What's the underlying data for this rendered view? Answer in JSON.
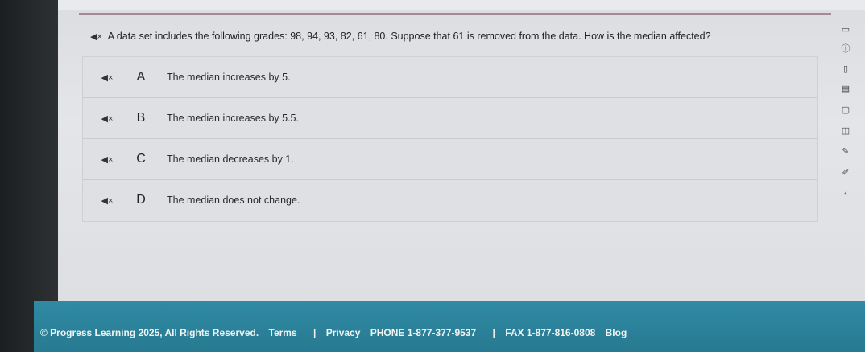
{
  "question": {
    "text": "A data set includes the following grades: 98, 94, 93, 82, 61, 80. Suppose that 61 is removed from the data. How is the median affected?"
  },
  "options": [
    {
      "letter": "A",
      "text": "The median increases by 5."
    },
    {
      "letter": "B",
      "text": "The median increases by 5.5."
    },
    {
      "letter": "C",
      "text": "The median decreases by 1."
    },
    {
      "letter": "D",
      "text": "The median does not change."
    }
  ],
  "toolbar": {
    "icons": [
      "bookmark-icon",
      "info-icon",
      "calculator-icon",
      "notes-icon",
      "formula-icon",
      "reference-icon",
      "pencil-icon",
      "highlighter-icon",
      "scroll-icon"
    ]
  },
  "footer": {
    "copyright": "© Progress Learning 2025, All Rights Reserved.",
    "terms": "Terms",
    "privacy": "Privacy",
    "phone": "PHONE 1-877-377-9537",
    "fax": "FAX 1-877-816-0808",
    "blog": "Blog"
  }
}
